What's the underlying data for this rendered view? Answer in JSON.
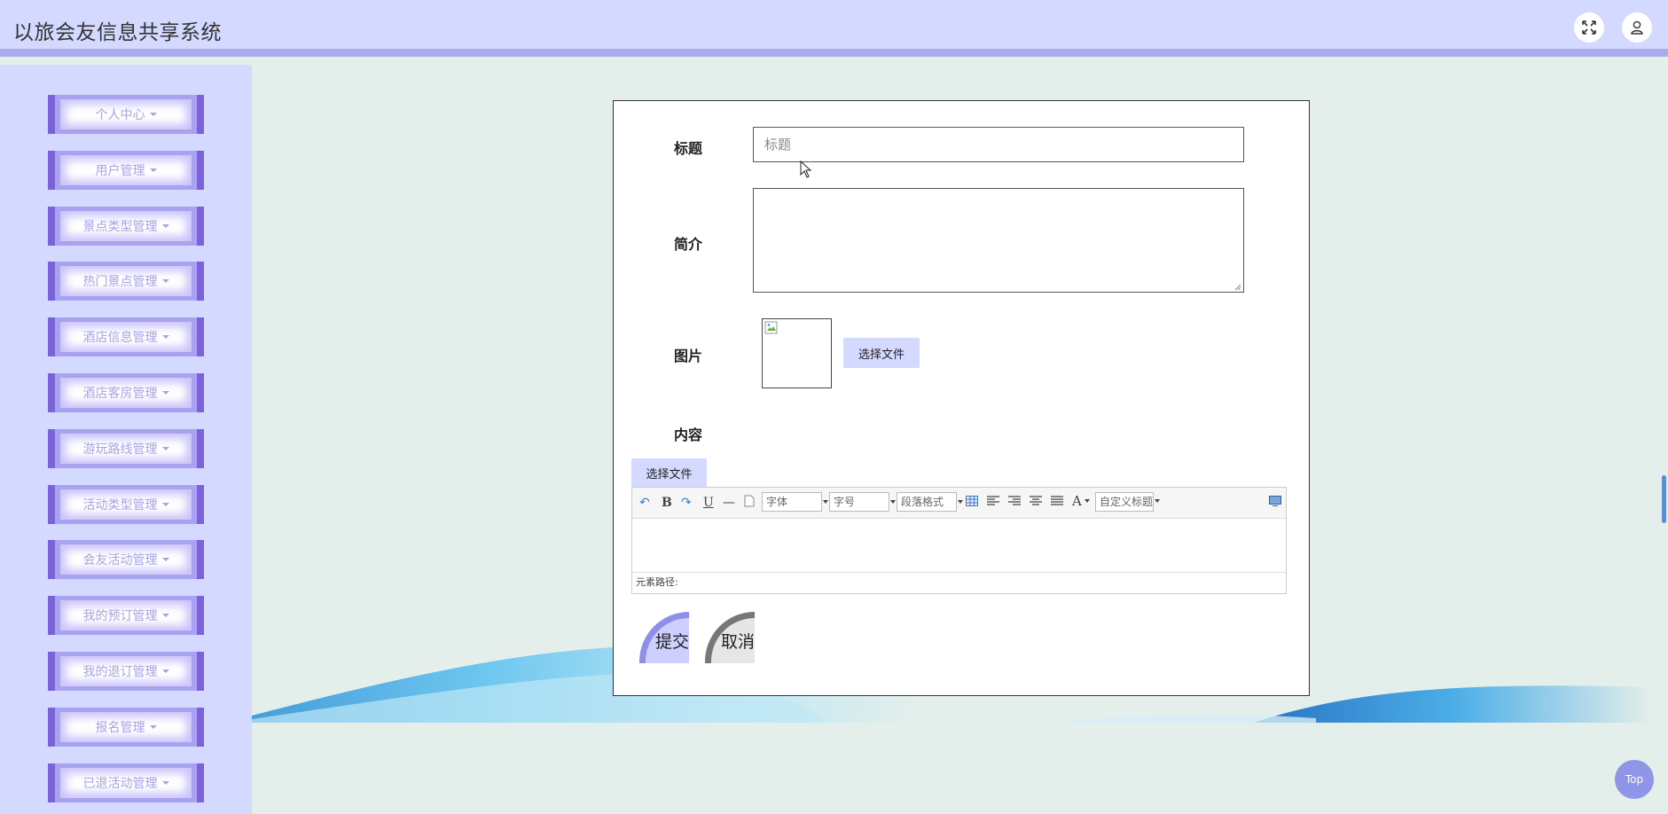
{
  "header": {
    "title": "以旅会友信息共享系统"
  },
  "sidebar": {
    "items": [
      {
        "label": "个人中心"
      },
      {
        "label": "用户管理"
      },
      {
        "label": "景点类型管理"
      },
      {
        "label": "热门景点管理"
      },
      {
        "label": "酒店信息管理"
      },
      {
        "label": "酒店客房管理"
      },
      {
        "label": "游玩路线管理"
      },
      {
        "label": "活动类型管理"
      },
      {
        "label": "会友活动管理"
      },
      {
        "label": "我的预订管理"
      },
      {
        "label": "我的退订管理"
      },
      {
        "label": "报名管理"
      },
      {
        "label": "已退活动管理"
      }
    ]
  },
  "form": {
    "title_label": "标题",
    "title_placeholder": "标题",
    "title_value": "",
    "intro_label": "简介",
    "intro_value": "",
    "image_label": "图片",
    "image_file_button": "选择文件",
    "content_label": "内容",
    "content_file_button": "选择文件",
    "editor": {
      "font_select": "字体",
      "size_select": "字号",
      "paragraph_select": "段落格式",
      "custom_title_select": "自定义标题",
      "path_label": "元素路径:"
    },
    "submit_label": "提交",
    "cancel_label": "取消"
  },
  "back_to_top": "Top",
  "colors": {
    "header_bg": "#d3d9ff",
    "sidebar_bg": "#d3d9ff",
    "accent_purple": "#7b62da",
    "page_bg": "#e4efeb"
  }
}
